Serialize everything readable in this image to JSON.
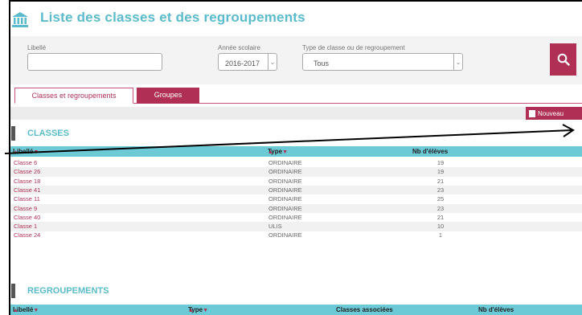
{
  "header": {
    "title": "Liste des classes et des regroupements",
    "icon": "bank-icon"
  },
  "filters": {
    "libelle_label": "Libellé",
    "libelle_value": "",
    "annee_label": "Année scolaire",
    "annee_value": "2016-2017",
    "type_label": "Type de classe ou de regroupement",
    "type_value": "Tous"
  },
  "tabs": {
    "active": "Classes et regroupements",
    "inactive": "Groupes"
  },
  "toolbar": {
    "new_label": "Nouveau"
  },
  "classes": {
    "title": "CLASSES",
    "columns": {
      "libelle": "Libellé",
      "type": "Type",
      "nb": "Nb d'élèves"
    },
    "rows": [
      {
        "name": "Classe 6",
        "type": "ORDINAIRE",
        "nb": "19"
      },
      {
        "name": "Classe 26",
        "type": "ORDINAIRE",
        "nb": "19"
      },
      {
        "name": "Classe 18",
        "type": "ORDINAIRE",
        "nb": "21"
      },
      {
        "name": "Classe 41",
        "type": "ORDINAIRE",
        "nb": "23"
      },
      {
        "name": "Classe 11",
        "type": "ORDINAIRE",
        "nb": "25"
      },
      {
        "name": "Classe 9",
        "type": "ORDINAIRE",
        "nb": "23"
      },
      {
        "name": "Classe 40",
        "type": "ORDINAIRE",
        "nb": "21"
      },
      {
        "name": "Classe 1",
        "type": "ULIS",
        "nb": "10"
      },
      {
        "name": "Classe 24",
        "type": "ORDINAIRE",
        "nb": "1"
      }
    ]
  },
  "regroupements": {
    "title": "REGROUPEMENTS",
    "columns": {
      "libelle": "Libellé",
      "type": "Type",
      "classes": "Classes associées",
      "nb": "Nb d'élèves"
    }
  },
  "colors": {
    "accent": "#b03055",
    "title": "#5bbbcc",
    "header_row": "#6cc9d6"
  }
}
